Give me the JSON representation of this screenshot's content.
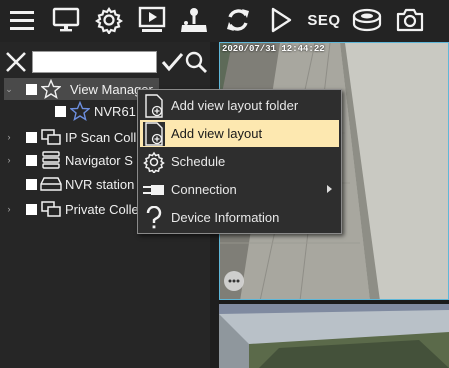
{
  "toolbar": {
    "items": [
      {
        "icon": "menu-icon"
      },
      {
        "icon": "monitor-icon"
      },
      {
        "icon": "gear-icon"
      },
      {
        "icon": "playback-icon"
      },
      {
        "icon": "joystick-icon"
      },
      {
        "icon": "refresh-icon"
      },
      {
        "icon": "play-icon"
      },
      {
        "icon": "sequence-icon",
        "label": "SEQ"
      },
      {
        "icon": "disk-stack-icon"
      },
      {
        "icon": "camera-icon"
      }
    ]
  },
  "search": {
    "value": ""
  },
  "tree": [
    {
      "label": "View Manager",
      "icon": "star-icon",
      "expanded": true,
      "selected": true
    },
    {
      "label": "NVR61",
      "icon": "star-outline-icon"
    },
    {
      "label": "IP Scan Coll",
      "icon": "layers-icon"
    },
    {
      "label": "Navigator S",
      "icon": "server-stack-icon"
    },
    {
      "label": "NVR station",
      "icon": "nvr-icon"
    },
    {
      "label": "Private Colle",
      "icon": "layers-icon"
    }
  ],
  "video": {
    "timestamp": "2020/07/31 12:44:22"
  },
  "context_menu": {
    "items": [
      {
        "label": "Add view layout folder",
        "icon": "add-folder-icon"
      },
      {
        "label": "Add view layout",
        "icon": "add-layout-icon",
        "highlighted": true
      },
      {
        "label": "Schedule",
        "icon": "gear-icon"
      },
      {
        "label": "Connection",
        "icon": "connection-icon",
        "submenu": true
      },
      {
        "label": "Device Information",
        "icon": "question-icon"
      }
    ]
  },
  "colors": {
    "highlight": "#fde8b0",
    "tile_border": "#5fb7d8",
    "background": "#2b2b2b"
  }
}
